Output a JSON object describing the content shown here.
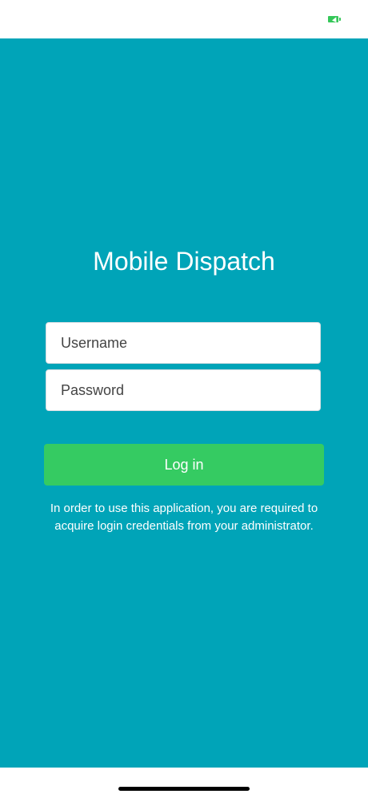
{
  "status_bar": {
    "battery_icon": "battery-charging-icon",
    "battery_color": "#35c759"
  },
  "login": {
    "title": "Mobile Dispatch",
    "username_placeholder": "Username",
    "password_placeholder": "Password",
    "login_label": "Log in",
    "notice": "In order to use this application, you are required to acquire login credentials from your administrator."
  },
  "colors": {
    "background": "#00a4b8",
    "button": "#35cb62"
  },
  "home_indicator": {
    "icon": "home-indicator"
  }
}
